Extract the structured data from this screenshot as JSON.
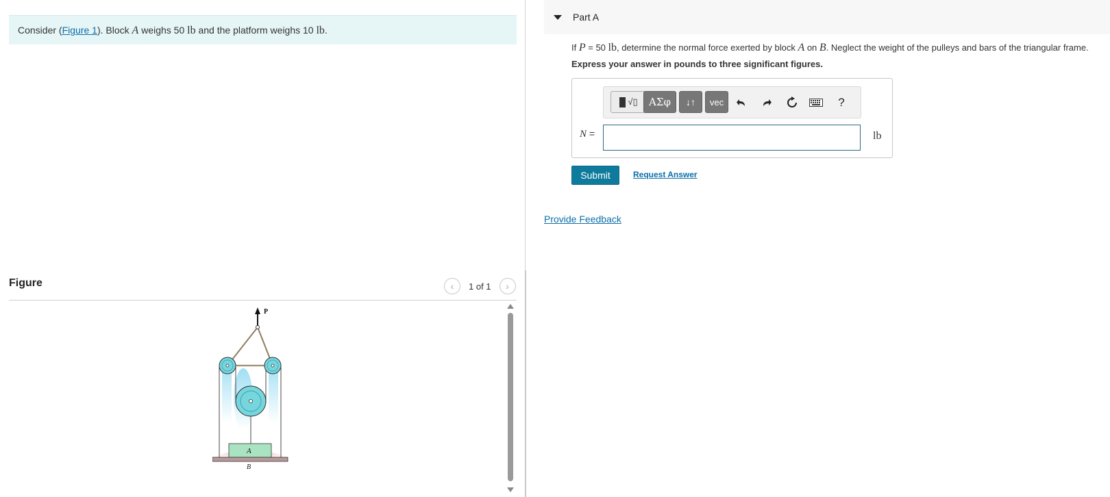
{
  "intro": {
    "prefix": "Consider (",
    "figure_link": "Figure 1",
    "mid1": "). Block ",
    "block_a": "A",
    "mid2": " weighs 50 ",
    "unit1": "lb",
    "mid3": " and the platform weighs 10 ",
    "unit2": "lb",
    "suffix": "."
  },
  "figure": {
    "title": "Figure",
    "pager": "1 of 1",
    "prev_icon": "chevron-left-icon",
    "next_icon": "chevron-right-icon",
    "label_p": "P",
    "label_a": "A",
    "label_b": "B",
    "colors": {
      "pulley": "#76d6de",
      "block": "#a9e3c2",
      "platform": "#b89a9a",
      "frame": "#d8c4a4"
    }
  },
  "part": {
    "title": "Part A",
    "question": {
      "t1": "If ",
      "p": "P",
      "t2": " = 50 ",
      "lb": "lb",
      "t3": ", determine the normal force exerted by block ",
      "a": "A",
      "t4": " on ",
      "b": "B",
      "t5": ". Neglect the weight of the pulleys and bars of the triangular frame."
    },
    "instruction": "Express your answer in pounds to three significant figures.",
    "toolbar": {
      "frac_sqrt": "√▯",
      "greek": "ΑΣφ",
      "arrows": "↓↑",
      "vec": "vec",
      "help": "?"
    },
    "answer_label": "N",
    "answer_equals": " =",
    "answer_value": "",
    "unit": "lb",
    "submit": "Submit",
    "request": "Request Answer"
  },
  "feedback": "Provide Feedback"
}
